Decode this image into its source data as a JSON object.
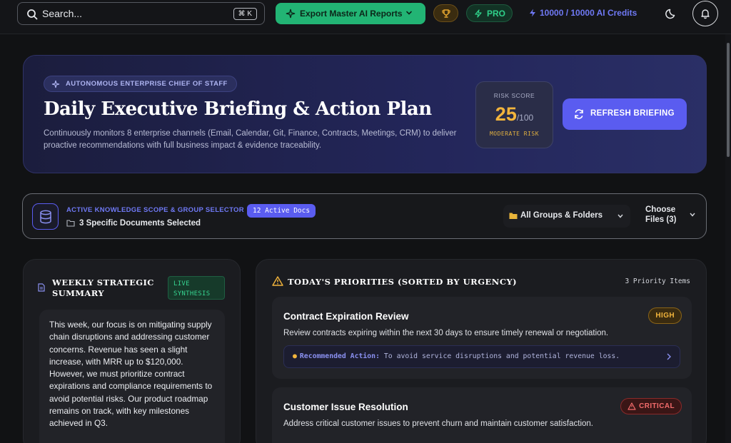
{
  "topbar": {
    "search_placeholder": "Search...",
    "search_shortcut": "⌘ K",
    "export_label": "Export Master AI Reports",
    "pro_label": "PRO",
    "credits": "10000 / 10000 AI Credits",
    "icons": [
      "search-icon",
      "sparkle-icon",
      "chevron-down-icon",
      "trophy-icon",
      "bolt-icon",
      "moon-icon",
      "bell-icon"
    ]
  },
  "hero": {
    "badge": "AUTONOMOUS ENTERPRISE CHIEF OF STAFF",
    "title": "Daily Executive Briefing & Action Plan",
    "description": "Continuously monitors 8 enterprise channels (Email, Calendar, Git, Finance, Contracts, Meetings, CRM) to deliver proactive recommendations with full business impact & evidence traceability.",
    "risk_label": "RISK SCORE",
    "risk_value": "25",
    "risk_max": "/100",
    "risk_level": "MODERATE RISK",
    "refresh_label": "REFRESH BRIEFING"
  },
  "scope": {
    "title": "ACTIVE KNOWLEDGE SCOPE & GROUP SELECTOR",
    "docs_badge": "12 Active Docs",
    "selected": "3 Specific Documents Selected",
    "groups_label": "All Groups & Folders",
    "choose_label": "Choose Files (3)"
  },
  "weekly": {
    "title": "WEEKLY STRATEGIC SUMMARY",
    "live_badge": "LIVE SYNTHESIS",
    "body": "This week, our focus is on mitigating supply chain disruptions and addressing customer concerns. Revenue has seen a slight increase, with MRR up to $120,000. However, we must prioritize contract expirations and compliance requirements to avoid potential risks. Our product roadmap remains on track, with key milestones achieved in Q3."
  },
  "priorities": {
    "title": "TODAY'S PRIORITIES (SORTED BY URGENCY)",
    "count": "3 Priority Items",
    "items": [
      {
        "title": "Contract Expiration Review",
        "badge": "HIGH",
        "description": "Review contracts expiring within the next 30 days to ensure timely renewal or negotiation.",
        "rec_key": "Recommended Action:",
        "rec_text": " To avoid service disruptions and potential revenue loss."
      },
      {
        "title": "Customer Issue Resolution",
        "badge": "CRITICAL",
        "description": "Address critical customer issues to prevent churn and maintain customer satisfaction."
      }
    ]
  },
  "colors": {
    "accent": "#5a5cf0",
    "success": "#22b474",
    "warning": "#f2b43c",
    "danger": "#f26b6b",
    "background": "#111214"
  }
}
